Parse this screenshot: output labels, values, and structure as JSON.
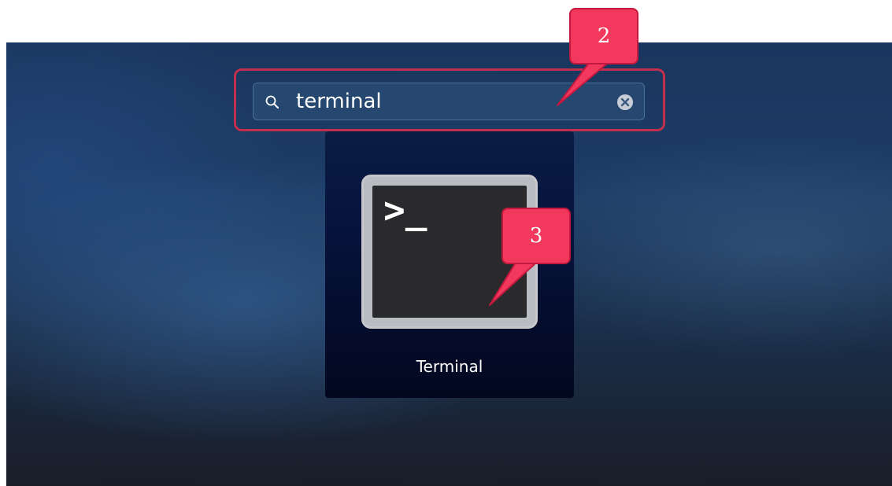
{
  "search": {
    "query": "terminal",
    "icon": "magnifier-icon",
    "clear_icon": "clear-circle-x-icon"
  },
  "result": {
    "app_label": "Terminal",
    "icon": "terminal-app-icon",
    "prompt_glyph": ">_"
  },
  "annotations": {
    "step_2": "2",
    "step_3": "3",
    "color": "#f2385c",
    "border_color": "#c12f4e"
  }
}
